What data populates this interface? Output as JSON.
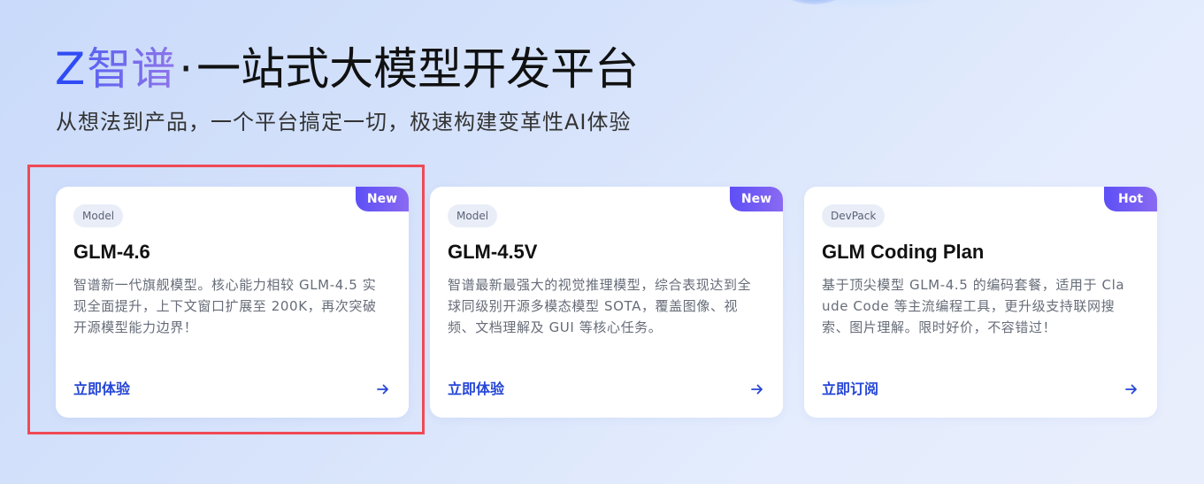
{
  "hero": {
    "brand_letter": "Z",
    "brand_name": "智谱",
    "separator": "·",
    "title": "一站式大模型开发平台",
    "subtitle": "从想法到产品，一个平台搞定一切，极速构建变革性AI体验"
  },
  "cards": [
    {
      "badge": "New",
      "tag": "Model",
      "title": "GLM-4.6",
      "description": "智谱新一代旗舰模型。核心能力相较 GLM-4.5 实现全面提升，上下文窗口扩展至 200K，再次突破开源模型能力边界！",
      "cta_label": "立即体验",
      "icon": "arrow-right-icon",
      "highlighted": true
    },
    {
      "badge": "New",
      "tag": "Model",
      "title": "GLM-4.5V",
      "description": "智谱最新最强大的视觉推理模型，综合表现达到全球同级别开源多模态模型 SOTA，覆盖图像、视频、文档理解及 GUI 等核心任务。",
      "cta_label": "立即体验",
      "icon": "arrow-right-icon",
      "highlighted": false
    },
    {
      "badge": "Hot",
      "tag": "DevPack",
      "title": "GLM Coding Plan",
      "description": "基于顶尖模型 GLM-4.5 的编码套餐，适用于 Claude Code 等主流编程工具，更升级支持联网搜索、图片理解。限时好价，不容错过！",
      "cta_label": "立即订阅",
      "icon": "arrow-right-icon",
      "highlighted": false
    }
  ],
  "colors": {
    "accent": "#2546d6",
    "badge_gradient_start": "#5d4ff6",
    "badge_gradient_end": "#8a6af1",
    "highlight_border": "#ef4a56"
  }
}
